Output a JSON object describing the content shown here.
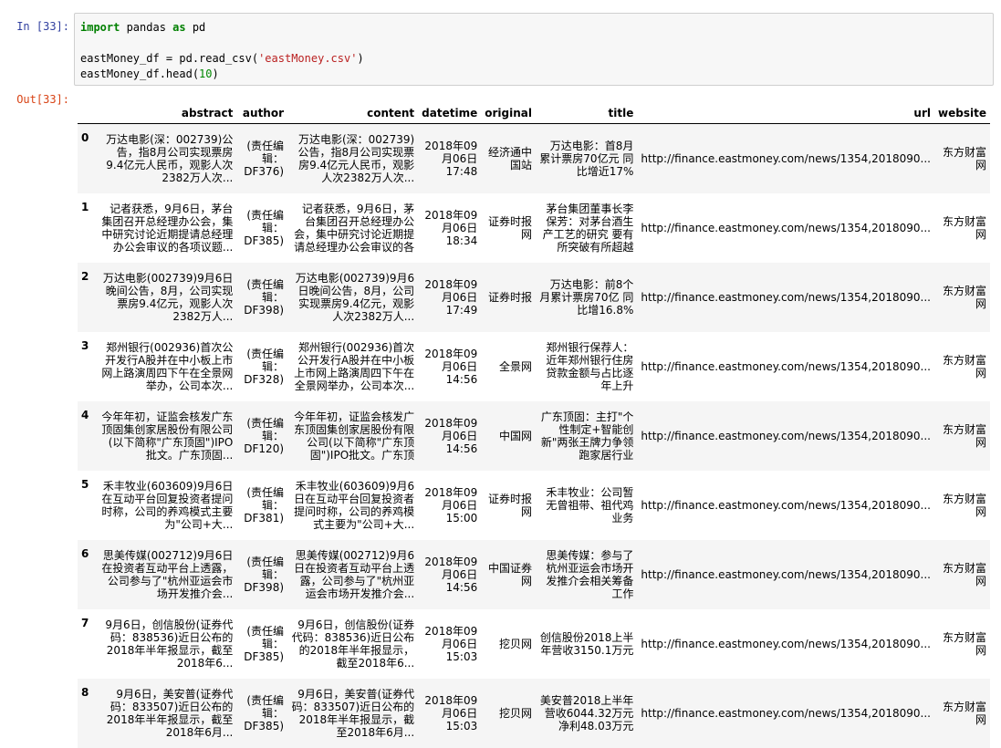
{
  "cell": {
    "input_prompt": "In [33]:",
    "output_prompt": "Out[33]:",
    "code": {
      "line1": {
        "kw1": "import",
        "t1": " pandas ",
        "kw2": "as",
        "t2": " pd"
      },
      "line3": {
        "t1": "eastMoney_df = pd.read_csv(",
        "str": "'eastMoney.csv'",
        "t2": ")"
      },
      "line4": {
        "t1": "eastMoney_df.head(",
        "num": "10",
        "t2": ")"
      }
    }
  },
  "table": {
    "columns": [
      "abstract",
      "author",
      "content",
      "datetime",
      "original",
      "title",
      "url",
      "website"
    ],
    "rows": [
      {
        "index": "0",
        "abstract": "万达电影(深：002739)公告，指8月公司实现票房9.4亿元人民币，观影人次2382万人次...",
        "author": "(责任编辑：DF376)",
        "content": "万达电影(深：002739)公告，指8月公司实现票房9.4亿元人民币，观影人次2382万人次...",
        "datetime": "2018年09月06日 17:48",
        "original": "经济通中国站",
        "title": "万达电影：首8月累计票房70亿元 同比增近17%",
        "url": "http://finance.eastmoney.com/news/1354,2018090...",
        "website": "东方财富网"
      },
      {
        "index": "1",
        "abstract": "记者获悉，9月6日，茅台集团召开总经理办公会，集中研究讨论近期提请总经理办公会审议的各项议题...",
        "author": "(责任编辑：DF385)",
        "content": "记者获悉，9月6日，茅台集团召开总经理办公会，集中研究讨论近期提请总经理办公会审议的各项议题...",
        "datetime": "2018年09月06日 18:34",
        "original": "证券时报网",
        "title": "茅台集团董事长李保芳：对茅台酒生产工艺的研究 要有所突破有所超越",
        "url": "http://finance.eastmoney.com/news/1354,2018090...",
        "website": "东方财富网"
      },
      {
        "index": "2",
        "abstract": "万达电影(002739)9月6日晚间公告，8月，公司实现票房9.4亿元，观影人次2382万人...",
        "author": "(责任编辑：DF398)",
        "content": "万达电影(002739)9月6日晚间公告，8月，公司实现票房9.4亿元，观影人次2382万人...",
        "datetime": "2018年09月06日 17:49",
        "original": "证券时报",
        "title": "万达电影：前8个月累计票房70亿 同比增16.8%",
        "url": "http://finance.eastmoney.com/news/1354,2018090...",
        "website": "东方财富网"
      },
      {
        "index": "3",
        "abstract": "郑州银行(002936)首次公开发行A股并在中小板上市网上路演周四下午在全景网举办，公司本次...",
        "author": "(责任编辑：DF328)",
        "content": "郑州银行(002936)首次公开发行A股并在中小板上市网上路演周四下午在全景网举办，公司本次...",
        "datetime": "2018年09月06日 14:56",
        "original": "全景网",
        "title": "郑州银行保荐人：近年郑州银行住房贷款金额与占比逐年上升",
        "url": "http://finance.eastmoney.com/news/1354,2018090...",
        "website": "东方财富网"
      },
      {
        "index": "4",
        "abstract": "今年年初，证监会核发广东顶固集创家居股份有限公司(以下简称\"广东顶固\")IPO批文。广东顶固...",
        "author": "(责任编辑：DF120)",
        "content": "今年年初，证监会核发广东顶固集创家居股份有限公司(以下简称\"广东顶固\")IPO批文。广东顶固...",
        "datetime": "2018年09月06日 14:56",
        "original": "中国网",
        "title": "广东顶固：主打\"个性制定+智能创新\"两张王牌力争领跑家居行业",
        "url": "http://finance.eastmoney.com/news/1354,2018090...",
        "website": "东方财富网"
      },
      {
        "index": "5",
        "abstract": "禾丰牧业(603609)9月6日在互动平台回复投资者提问时称，公司的养鸡模式主要为\"公司+大...",
        "author": "(责任编辑：DF381)",
        "content": "禾丰牧业(603609)9月6日在互动平台回复投资者提问时称，公司的养鸡模式主要为\"公司+大...",
        "datetime": "2018年09月06日 15:00",
        "original": "证券时报网",
        "title": "禾丰牧业：公司暂无曾祖带、祖代鸡业务",
        "url": "http://finance.eastmoney.com/news/1354,2018090...",
        "website": "东方财富网"
      },
      {
        "index": "6",
        "abstract": "思美传媒(002712)9月6日在投资者互动平台上透露，公司参与了\"杭州亚运会市场开发推介会...",
        "author": "(责任编辑：DF398)",
        "content": "思美传媒(002712)9月6日在投资者互动平台上透露，公司参与了\"杭州亚运会市场开发推介会...",
        "datetime": "2018年09月06日 14:56",
        "original": "中国证券网",
        "title": "思美传媒：参与了杭州亚运会市场开发推介会相关筹备工作",
        "url": "http://finance.eastmoney.com/news/1354,2018090...",
        "website": "东方财富网"
      },
      {
        "index": "7",
        "abstract": "9月6日，创信股份(证券代码：838536)近日公布的2018年半年报显示，截至2018年6...",
        "author": "(责任编辑：DF385)",
        "content": "9月6日，创信股份(证券代码：838536)近日公布的2018年半年报显示，截至2018年6...",
        "datetime": "2018年09月06日 15:03",
        "original": "挖贝网",
        "title": "创信股份2018上半年营收3150.1万元",
        "url": "http://finance.eastmoney.com/news/1354,2018090...",
        "website": "东方财富网"
      },
      {
        "index": "8",
        "abstract": "9月6日，美安普(证券代码：833507)近日公布的2018年半年报显示，截至2018年6月...",
        "author": "(责任编辑：DF385)",
        "content": "9月6日，美安普(证券代码：833507)近日公布的2018年半年报显示，截至2018年6月...",
        "datetime": "2018年09月06日 15:03",
        "original": "挖贝网",
        "title": "美安普2018上半年营收6044.32万元 净利48.03万元",
        "url": "http://finance.eastmoney.com/news/1354,2018090...",
        "website": "东方财富网"
      }
    ]
  }
}
